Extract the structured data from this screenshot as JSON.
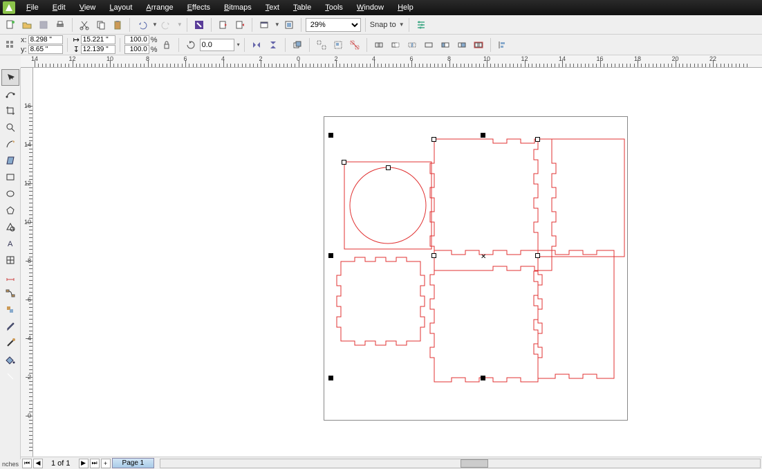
{
  "menu": {
    "items": [
      "File",
      "Edit",
      "View",
      "Layout",
      "Arrange",
      "Effects",
      "Bitmaps",
      "Text",
      "Table",
      "Tools",
      "Window",
      "Help"
    ]
  },
  "toolbar1": {
    "zoom": "29%",
    "snap": "Snap to"
  },
  "properties": {
    "x_label": "x:",
    "y_label": "y:",
    "x": "8.298 \"",
    "y": "8.65 \"",
    "w": "15.221 \"",
    "h": "12.139 \"",
    "scale_x": "100.0",
    "scale_y": "100.0",
    "pct": "%",
    "rotation": "0.0"
  },
  "ruler": {
    "h_labels": [
      "14",
      "12",
      "10",
      "8",
      "6",
      "4",
      "2",
      "0",
      "2",
      "4",
      "6",
      "8",
      "10",
      "12",
      "14",
      "16",
      "18",
      "20",
      "22"
    ],
    "v_labels": [
      "16",
      "14",
      "12",
      "10",
      "8",
      "6",
      "4",
      "2",
      "0"
    ],
    "unit": "nches"
  },
  "page_nav": {
    "counter": "1 of 1",
    "page_tab": "Page 1"
  },
  "toolbox_tools": [
    "pick-tool",
    "shape-tool",
    "crop-tool",
    "zoom-tool",
    "freehand-tool",
    "smart-fill-tool",
    "rectangle-tool",
    "ellipse-tool",
    "polygon-tool",
    "basic-shapes-tool",
    "text-tool",
    "table-tool",
    "dimension-tool",
    "connector-tool",
    "interactive-blend-tool",
    "eyedropper-tool",
    "outline-tool",
    "fill-tool",
    "interactive-fill-tool"
  ]
}
